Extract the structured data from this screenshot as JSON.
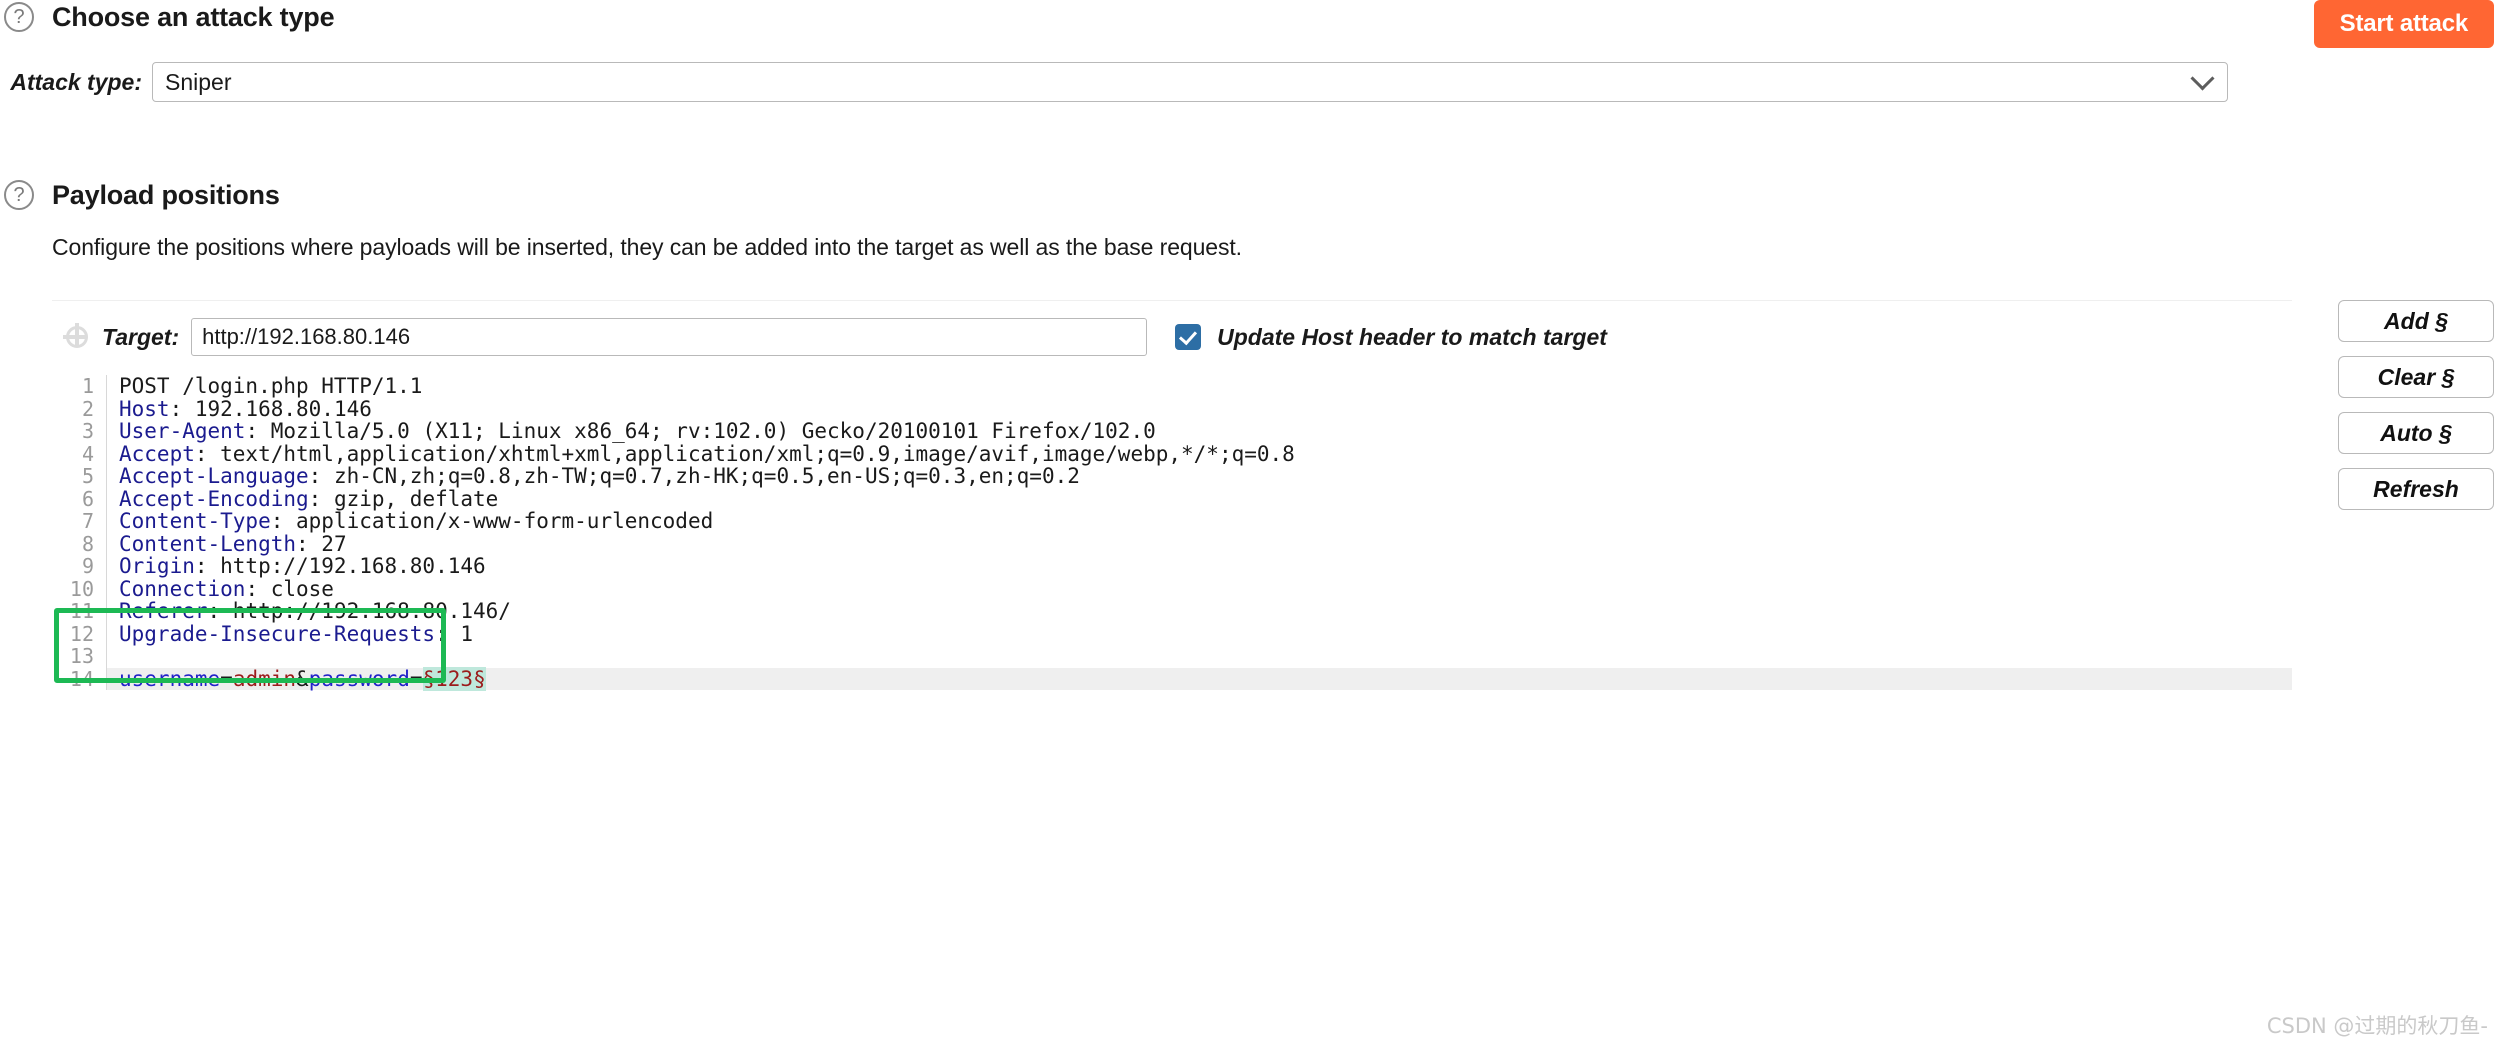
{
  "attack_section": {
    "help_icon": "help-circle-icon",
    "title": "Choose an attack type",
    "start_attack_label": "Start attack",
    "start_attack_color": "#ff6633",
    "attack_type_label": "Attack type:",
    "attack_type_value": "Sniper",
    "chevron_icon": "chevron-down-icon"
  },
  "payload_section": {
    "help_icon": "help-circle-icon",
    "title": "Payload positions",
    "description": "Configure the positions where payloads will be inserted, they can be added into the target as well as the base request.",
    "target_label": "Target:",
    "target_value": "http://192.168.80.146",
    "move_icon": "move-target-icon",
    "host_checkbox_checked": true,
    "host_checkbox_color": "#2d6ea5",
    "host_checkbox_label": "Update Host header to match target"
  },
  "side_buttons": [
    {
      "label": "Add §",
      "name": "add-section-button"
    },
    {
      "label": "Clear §",
      "name": "clear-section-button"
    },
    {
      "label": "Auto §",
      "name": "auto-section-button"
    },
    {
      "label": "Refresh",
      "name": "refresh-button"
    }
  ],
  "request": {
    "lines": [
      {
        "n": "1",
        "segs": [
          {
            "t": "POST /login.php HTTP/1.1",
            "c": "tok-plain"
          }
        ]
      },
      {
        "n": "2",
        "segs": [
          {
            "t": "Host",
            "c": "hdr"
          },
          {
            "t": ": 192.168.80.146",
            "c": "tok-plain"
          }
        ]
      },
      {
        "n": "3",
        "segs": [
          {
            "t": "User-Agent",
            "c": "hdr"
          },
          {
            "t": ": Mozilla/5.0 (X11; Linux x86_64; rv:102.0) Gecko/20100101 Firefox/102.0",
            "c": "tok-plain"
          }
        ]
      },
      {
        "n": "4",
        "segs": [
          {
            "t": "Accept",
            "c": "hdr"
          },
          {
            "t": ": text/html,application/xhtml+xml,application/xml;q=0.9,image/avif,image/webp,*/*;q=0.8",
            "c": "tok-plain"
          }
        ]
      },
      {
        "n": "5",
        "segs": [
          {
            "t": "Accept-Language",
            "c": "hdr"
          },
          {
            "t": ": zh-CN,zh;q=0.8,zh-TW;q=0.7,zh-HK;q=0.5,en-US;q=0.3,en;q=0.2",
            "c": "tok-plain"
          }
        ]
      },
      {
        "n": "6",
        "segs": [
          {
            "t": "Accept-Encoding",
            "c": "hdr"
          },
          {
            "t": ": gzip, deflate",
            "c": "tok-plain"
          }
        ]
      },
      {
        "n": "7",
        "segs": [
          {
            "t": "Content-Type",
            "c": "hdr"
          },
          {
            "t": ": application/x-www-form-urlencoded",
            "c": "tok-plain"
          }
        ]
      },
      {
        "n": "8",
        "segs": [
          {
            "t": "Content-Length",
            "c": "hdr"
          },
          {
            "t": ": 27",
            "c": "tok-plain"
          }
        ]
      },
      {
        "n": "9",
        "segs": [
          {
            "t": "Origin",
            "c": "hdr"
          },
          {
            "t": ": http://192.168.80.146",
            "c": "tok-plain"
          }
        ]
      },
      {
        "n": "10",
        "segs": [
          {
            "t": "Connection",
            "c": "hdr"
          },
          {
            "t": ": close",
            "c": "tok-plain"
          }
        ]
      },
      {
        "n": "11",
        "segs": [
          {
            "t": "Referer",
            "c": "hdr"
          },
          {
            "t": ": http://192.168.80.146/",
            "c": "tok-plain"
          }
        ]
      },
      {
        "n": "12",
        "segs": [
          {
            "t": "Upgrade-Insecure-Requests",
            "c": "hdr"
          },
          {
            "t": ": 1",
            "c": "tok-plain"
          }
        ]
      },
      {
        "n": "13",
        "segs": [
          {
            "t": "",
            "c": "tok-plain"
          }
        ]
      },
      {
        "n": "14",
        "highlight": true,
        "segs": [
          {
            "t": "username",
            "c": "tok-name"
          },
          {
            "t": "=",
            "c": "tok-plain"
          },
          {
            "t": "admin",
            "c": "tok-val"
          },
          {
            "t": "&",
            "c": "tok-plain"
          },
          {
            "t": "password",
            "c": "tok-name"
          },
          {
            "t": "=",
            "c": "tok-plain"
          },
          {
            "t": "§123§",
            "c": "payload-mark"
          }
        ]
      }
    ]
  },
  "watermark": "CSDN @过期的秋刀鱼-"
}
